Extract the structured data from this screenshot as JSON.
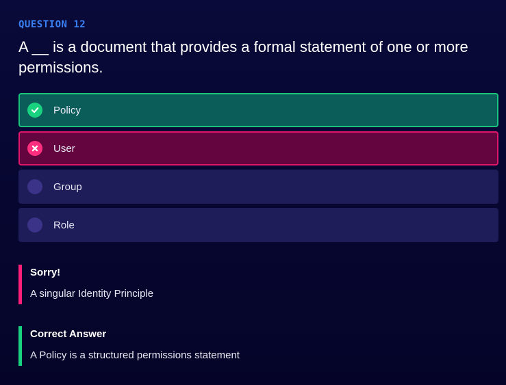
{
  "question": {
    "label": "QUESTION 12",
    "text": "A __ is a document that provides a formal statement of one or more permissions."
  },
  "options": [
    {
      "label": "Policy",
      "state": "correct",
      "icon": "check-icon"
    },
    {
      "label": "User",
      "state": "wrong",
      "icon": "close-icon"
    },
    {
      "label": "Group",
      "state": "neutral",
      "icon": "radio-dot-icon"
    },
    {
      "label": "Role",
      "state": "neutral",
      "icon": "radio-dot-icon"
    }
  ],
  "feedback": {
    "sorry": {
      "title": "Sorry!",
      "text": "A singular Identity Principle"
    },
    "correct": {
      "title": "Correct Answer",
      "text": "A Policy is a structured permissions statement"
    }
  },
  "colors": {
    "accent_blue": "#3b82f6",
    "correct_green": "#19d27f",
    "wrong_pink": "#ff1f7a",
    "background": "#0a0a3a"
  }
}
